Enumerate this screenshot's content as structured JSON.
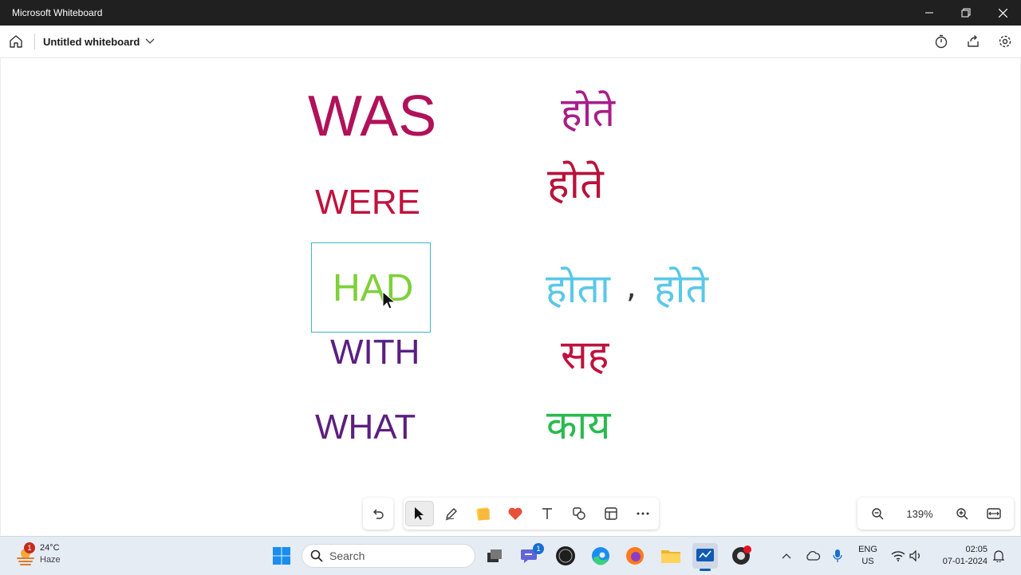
{
  "window": {
    "title": "Microsoft Whiteboard"
  },
  "app": {
    "board_title": "Untitled whiteboard"
  },
  "board": {
    "english": [
      {
        "text": "WAS",
        "color": "#b0125a"
      },
      {
        "text": "WERE",
        "color": "#c0123e"
      },
      {
        "text": "HAD",
        "color": "#7ed03a"
      },
      {
        "text": "WITH",
        "color": "#5b1f80"
      },
      {
        "text": "WHAT",
        "color": "#5b1f80"
      }
    ],
    "hindi": [
      {
        "text": "होते",
        "color": "#a81e8a"
      },
      {
        "text": "होते",
        "color": "#b8123a"
      },
      {
        "text": "होता",
        "color": "#5ac8e8"
      },
      {
        "text": ",",
        "color": "#333333"
      },
      {
        "text": "होते",
        "color": "#5ac8e8"
      },
      {
        "text": "सह",
        "color": "#c0123e"
      },
      {
        "text": "काय",
        "color": "#2aba4e"
      }
    ]
  },
  "zoom": {
    "level": "139%"
  },
  "taskbar": {
    "weather": {
      "temp": "24°C",
      "condition": "Haze",
      "badge": "1"
    },
    "search_placeholder": "Search",
    "chat_badge": "1",
    "lang_top": "ENG",
    "lang_bottom": "US",
    "time": "02:05",
    "date": "07-01-2024"
  }
}
